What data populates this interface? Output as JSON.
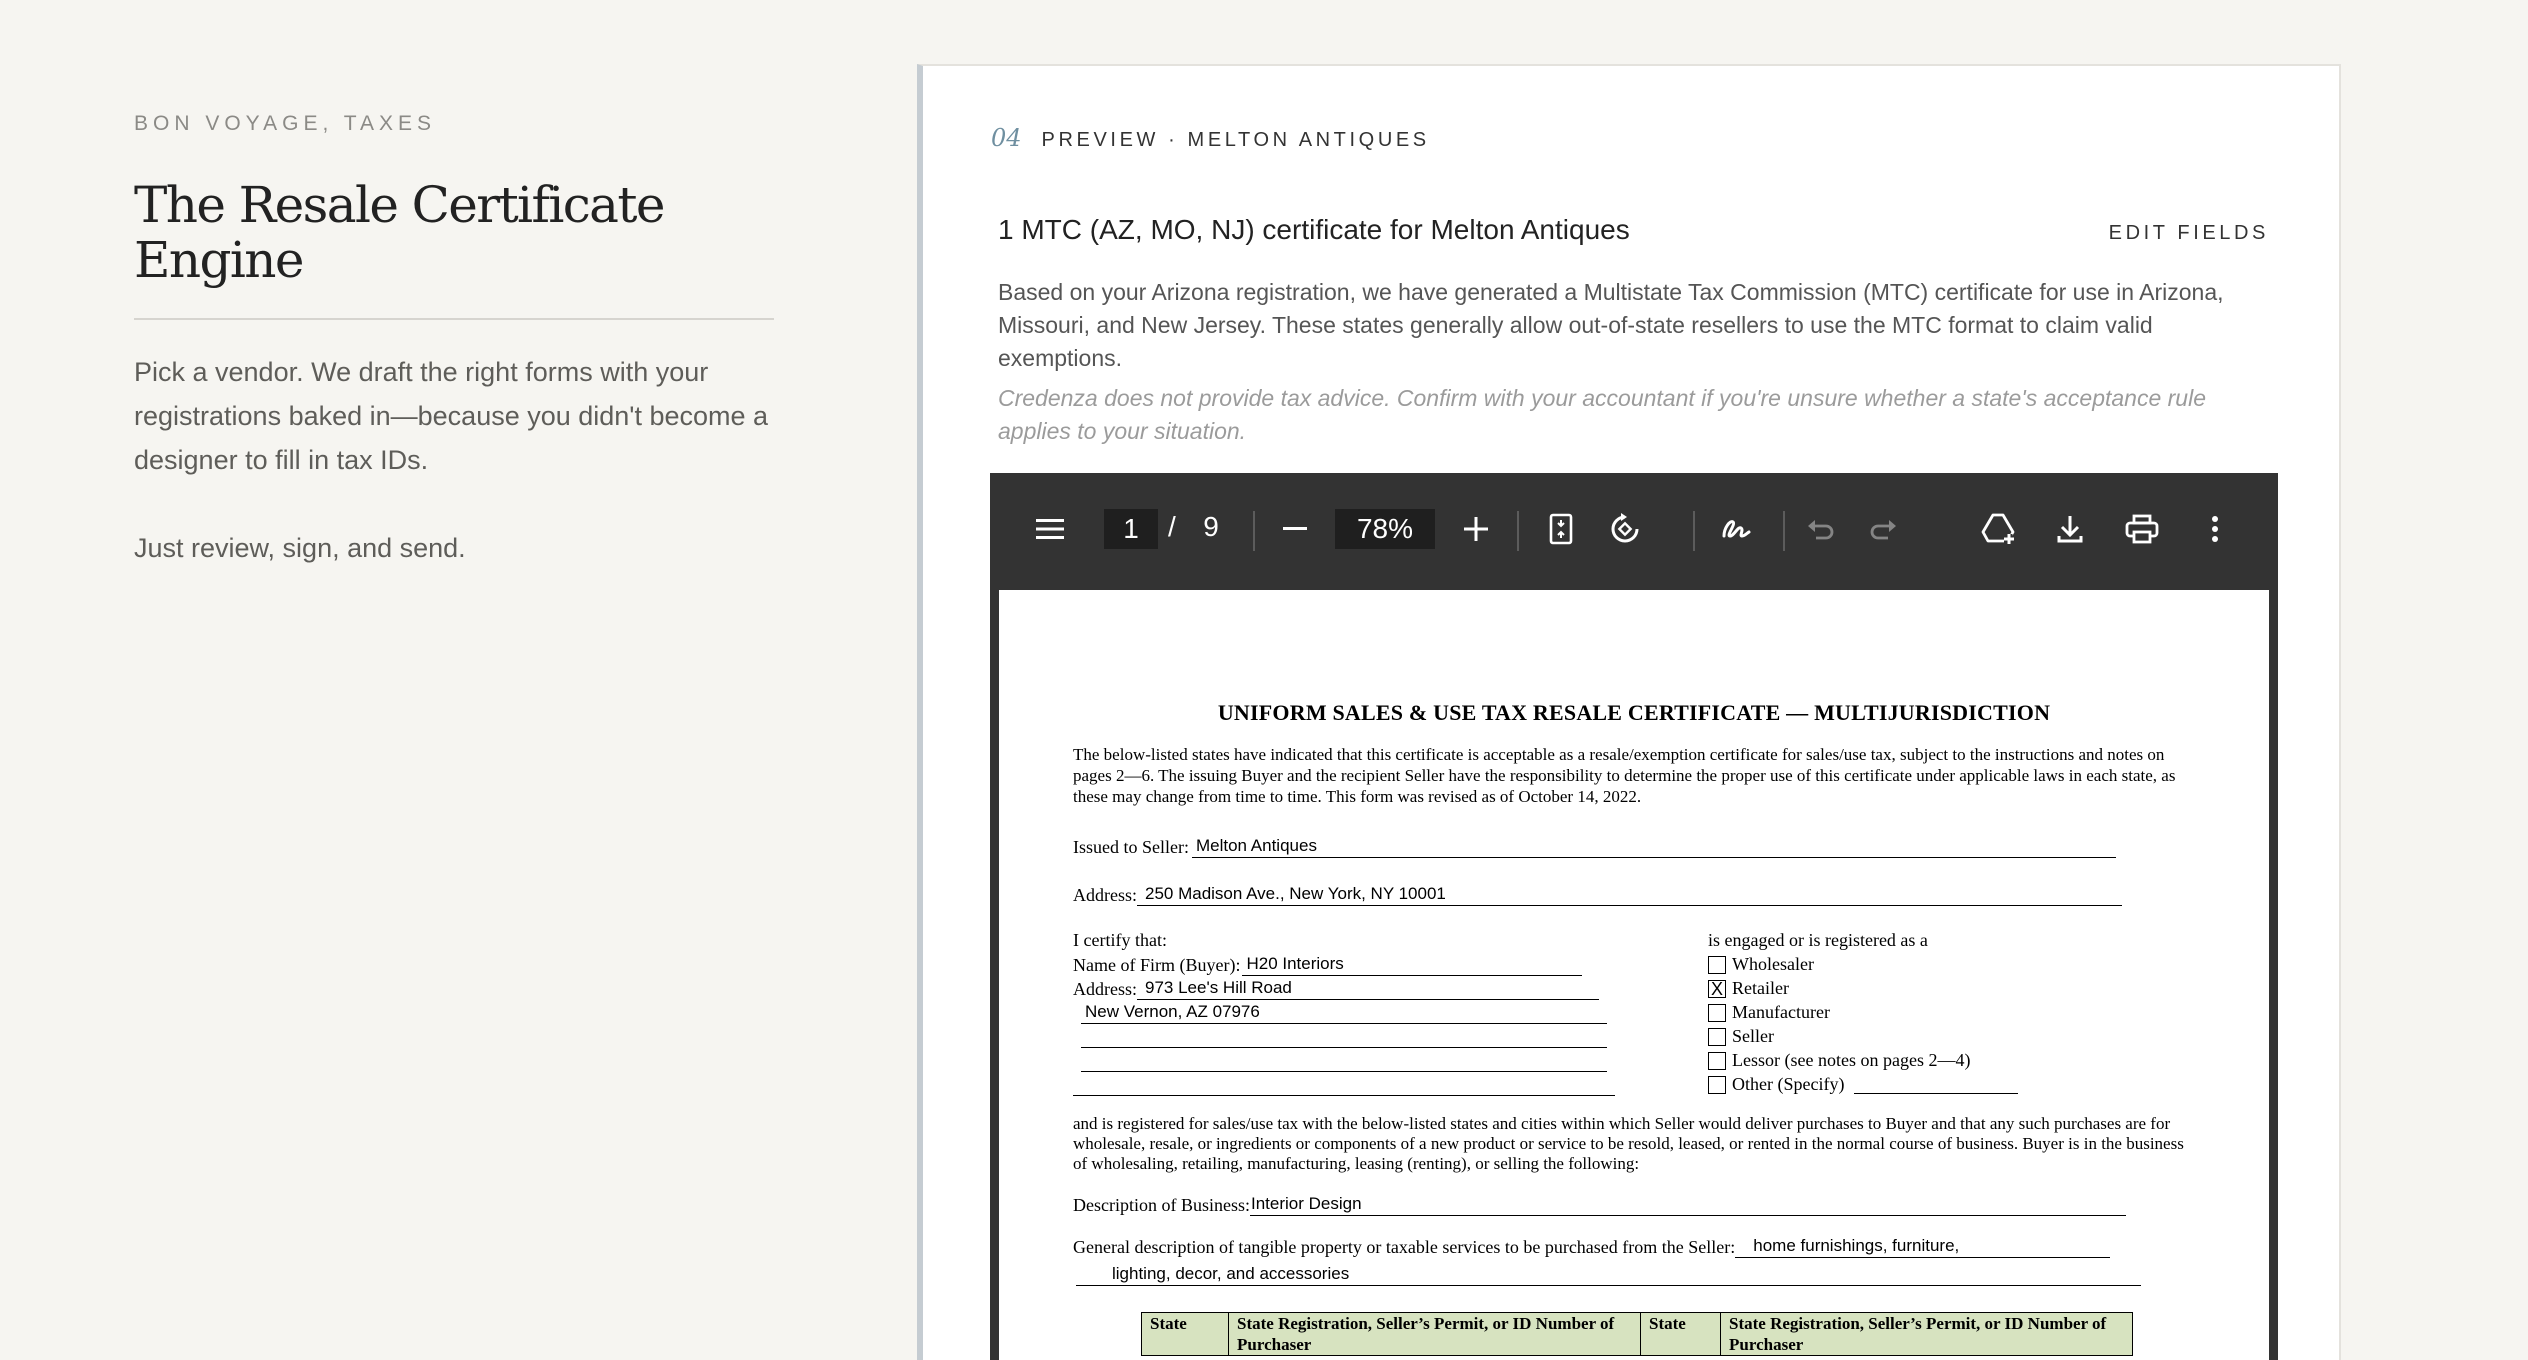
{
  "left": {
    "eyebrow": "BON VOYAGE, TAXES",
    "title": "The Resale Certificate Engine",
    "intro": "Pick a vendor. We draft the right forms with your registrations baked in—because you didn't become a designer to fill in tax IDs.",
    "cta_text": "Just review, sign, and send."
  },
  "preview": {
    "step_number": "04",
    "step_label": "PREVIEW · MELTON ANTIQUES",
    "title": "1 MTC (AZ, MO, NJ) certificate for Melton Antiques",
    "edit_label": "EDIT FIELDS",
    "description": "Based on your Arizona registration, we have generated a Multistate Tax Commission (MTC) certificate for use in Arizona, Missouri, and New Jersey. These states generally allow out-of-state resellers to use the MTC format to claim valid exemptions.",
    "disclaimer": "Credenza does not provide tax advice. Confirm with your accountant if you're unsure whether a state's acceptance rule applies to your situation."
  },
  "viewer": {
    "current_page": "1",
    "page_separator": "/",
    "total_pages": "9",
    "zoom": "78%",
    "icons": [
      "menu-icon",
      "zoom-out-icon",
      "zoom-in-icon",
      "fit-page-icon",
      "rotate-icon",
      "draw-icon",
      "undo-icon",
      "redo-icon",
      "add-to-drive-icon",
      "download-icon",
      "print-icon",
      "more-icon"
    ],
    "toolbar_color": "#333333"
  },
  "document": {
    "title": "UNIFORM SALES & USE TAX RESALE CERTIFICATE — MULTIJURISDICTION",
    "intro": "The below-listed states have indicated that this certificate is acceptable as a resale/exemption certificate for sales/use tax, subject to the instructions and notes on pages 2—6. The issuing Buyer and the recipient Seller have the responsibility to determine the proper use of this certificate under applicable laws in each state, as these may change from time to time. This form was revised as of October 14, 2022.",
    "seller_label": "Issued to Seller:",
    "seller_value": "Melton Antiques",
    "seller_address_label": "Address:",
    "seller_address_value": "250 Madison Ave., New York, NY 10001",
    "certify_label": "I certify that:",
    "buyer_name_label": "Name of Firm (Buyer):",
    "buyer_name_value": "H20 Interiors",
    "buyer_address_label": "Address:",
    "buyer_address_line1": "973 Lee's Hill Road",
    "buyer_address_line2": "New Vernon, AZ 07976",
    "engaged_label": "is engaged or is registered as a",
    "business_types": [
      {
        "label": "Wholesaler",
        "mark": ""
      },
      {
        "label": "Retailer",
        "mark": "X"
      },
      {
        "label": "Manufacturer",
        "mark": ""
      },
      {
        "label": "Seller",
        "mark": ""
      },
      {
        "label": "Lessor (see notes on pages 2—4)",
        "mark": ""
      },
      {
        "label": "Other (Specify)",
        "mark": ""
      }
    ],
    "registration_para": "and is registered for sales/use tax with the below-listed states and cities within which Seller would deliver purchases to Buyer and that any such purchases are for wholesale, resale, or ingredients or components of a new product or service to be resold, leased, or rented in the normal course of business. Buyer is in the business of wholesaling, retailing, manufacturing, leasing (renting), or selling the following:",
    "business_desc_label": "Description of Business:",
    "business_desc_value": "Interior Design",
    "property_label": "General description of tangible property or taxable services to be purchased from the Seller:",
    "property_value_line1": "home furnishings, furniture,",
    "property_value_line2": "lighting, decor, and accessories",
    "table_headers": [
      "State",
      "State Registration, Seller’s Permit, or ID Number of Purchaser",
      "State",
      "State Registration, Seller’s Permit, or ID Number of Purchaser"
    ],
    "table_header_color": "#d7e3c0"
  }
}
